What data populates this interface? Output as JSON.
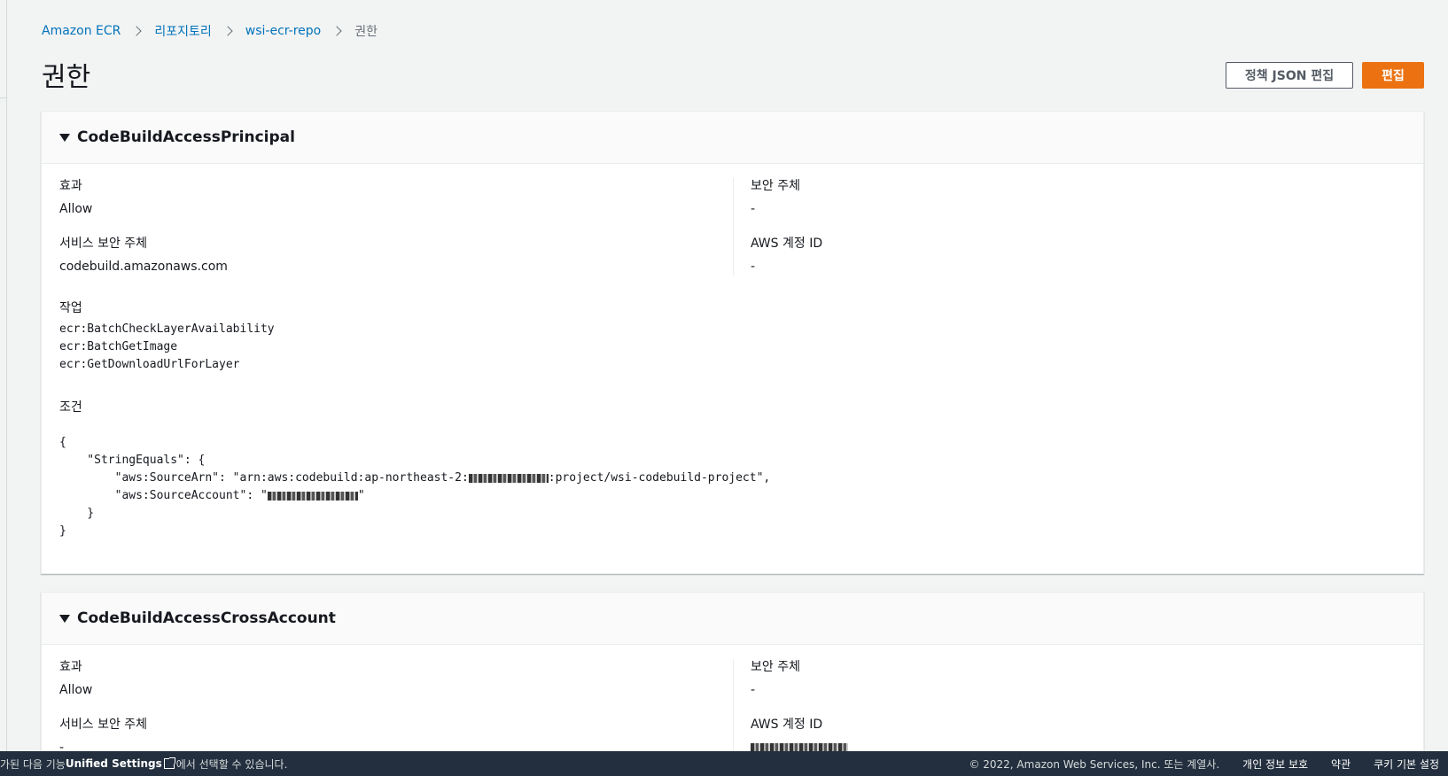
{
  "breadcrumb": {
    "items": [
      "Amazon ECR",
      "리포지토리",
      "wsi-ecr-repo"
    ],
    "current": "권한"
  },
  "page": {
    "title": "권한"
  },
  "actions": {
    "edit_json_label": "정책 JSON 편집",
    "edit_label": "편집"
  },
  "colors": {
    "primary": "#ec7211",
    "link": "#0073bb",
    "footer_bg": "#232f3e"
  },
  "statements": [
    {
      "name": "CodeBuildAccessPrincipal",
      "effect_label": "효과",
      "effect": "Allow",
      "principal_label": "보안 주체",
      "principal": "-",
      "service_principal_label": "서비스 보안 주체",
      "service_principal": "codebuild.amazonaws.com",
      "aws_account_label": "AWS 계정 ID",
      "aws_account": "-",
      "actions_label": "작업",
      "actions": [
        "ecr:BatchCheckLayerAvailability",
        "ecr:BatchGetImage",
        "ecr:GetDownloadUrlForLayer"
      ],
      "conditions_label": "조건",
      "conditions": {
        "open": "{",
        "string_equals_open": "    \"StringEquals\": {",
        "source_arn_prefix": "        \"aws:SourceArn\": \"arn:aws:codebuild:ap-northeast-2:",
        "source_arn_suffix": ":project/wsi-codebuild-project\",",
        "source_account_prefix": "        \"aws:SourceAccount\": \"",
        "source_account_suffix": "\"",
        "string_equals_close": "    }",
        "close": "}"
      }
    },
    {
      "name": "CodeBuildAccessCrossAccount",
      "effect_label": "효과",
      "effect": "Allow",
      "principal_label": "보안 주체",
      "principal": "-",
      "service_principal_label": "서비스 보안 주체",
      "service_principal": "-",
      "aws_account_label": "AWS 계정 ID"
    }
  ],
  "footer": {
    "notice_prefix": "가된 다음 기능 ",
    "notice_link": "Unified Settings",
    "notice_suffix": "에서 선택할 수 있습니다.",
    "copyright": "© 2022, Amazon Web Services, Inc. 또는 계열사.",
    "privacy": "개인 정보 보호",
    "terms": "약관",
    "cookies": "쿠키 기본 설정"
  }
}
